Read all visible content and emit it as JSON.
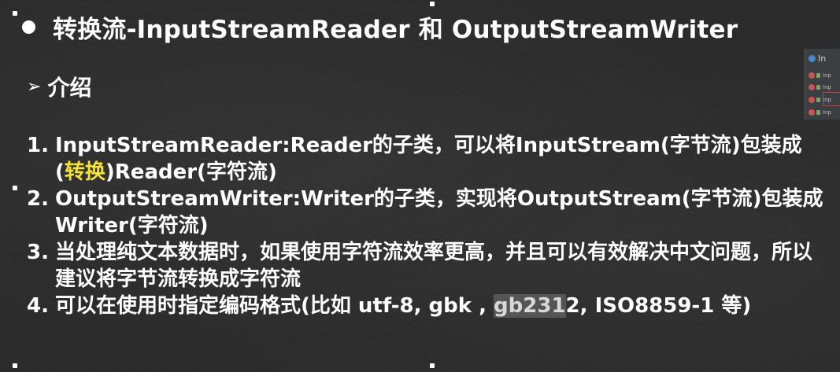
{
  "slide": {
    "title": "转换流-InputStreamReader 和 OutputStreamWriter",
    "section": "介绍",
    "items": [
      {
        "num": "1.",
        "parts": [
          {
            "text": "InputStreamReader:Reader的子类，可以将InputStream(字节流)包装成("
          },
          {
            "text": "转换",
            "style": "highlight"
          },
          {
            "text": ")Reader(字符流)"
          }
        ]
      },
      {
        "num": "2.",
        "parts": [
          {
            "text": "OutputStreamWriter:Writer的子类，实现将OutputStream(字节流)包装成Writer(字符流)"
          }
        ]
      },
      {
        "num": "3.",
        "parts": [
          {
            "text": "当处理纯文本数据时，如果使用字符流效率更高，并且可以有效解决中文问题，所以建议将字节流转换成字符流"
          }
        ]
      },
      {
        "num": "4.",
        "parts": [
          {
            "text": "可以在使用时指定编码格式(比如 utf-8, gbk , "
          },
          {
            "text": "gb231",
            "style": "dim"
          },
          {
            "text": "2, ISO8859-1 等)"
          }
        ]
      }
    ]
  },
  "ide_panel": {
    "title": "In",
    "rows": [
      "Inp",
      "Inp",
      "Inp",
      "Inp"
    ]
  },
  "colors": {
    "background": "#2b2b2b",
    "text": "#ffffff",
    "highlight": "#f3e43a"
  }
}
